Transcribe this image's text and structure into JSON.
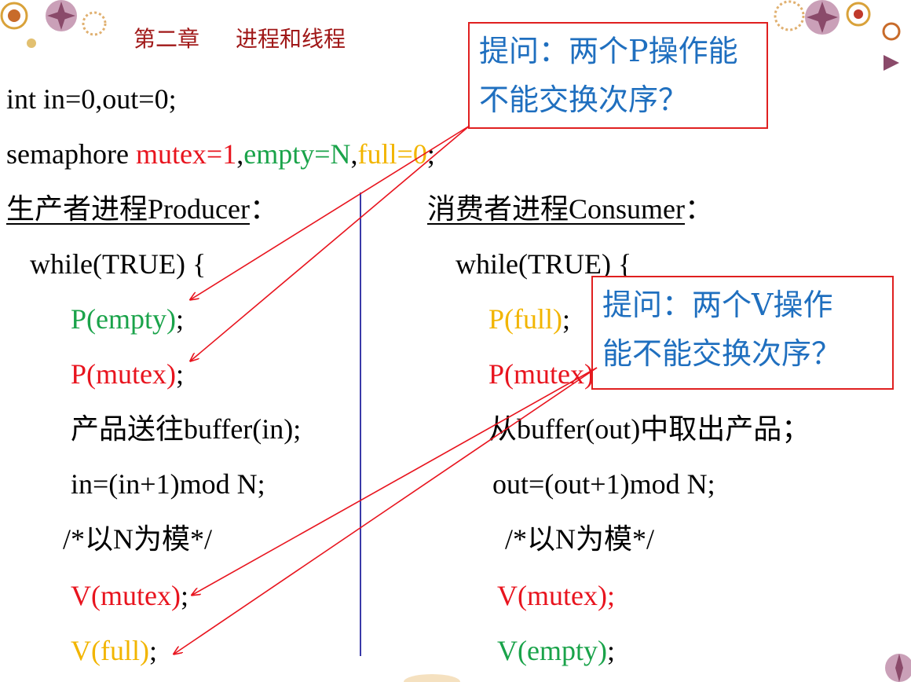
{
  "header": {
    "chapter": "第二章",
    "title": "进程和线程"
  },
  "decl": {
    "line1": "int in=0,out=0;",
    "semaphore_kw": "semaphore ",
    "mutex_init": "mutex=1",
    "comma1": ",",
    "empty_init": "empty=N",
    "comma2": ",",
    "full_init": "full=0",
    "semicolon": ";"
  },
  "producer": {
    "heading": "生产者进程Producer",
    "heading_colon": "：",
    "while": "while(TRUE) {",
    "p_empty": "P(empty)",
    "p_mutex": "P(mutex)",
    "put": "产品送往buffer(in);",
    "advance": "in=(in+1)mod N;",
    "comment": "/*以N为模*/",
    "v_mutex": "V(mutex)",
    "v_full": "V(full)",
    "semi": ";"
  },
  "consumer": {
    "heading": "消费者进程Consumer",
    "heading_colon": "：",
    "while": "while(TRUE) {",
    "p_full": "P(full)",
    "p_mutex": "P(mutex)",
    "take": "从buffer(out)中取出产品；",
    "advance": "out=(out+1)mod N;",
    "comment": "/*以N为模*/",
    "v_mutex": "V(mutex);",
    "v_empty": "V(empty)",
    "semi": ";"
  },
  "callouts": {
    "p_question_line1": "提问：两个P操作能",
    "p_question_line2": "不能交换次序？",
    "v_question_line1": "提问：两个V操作",
    "v_question_line2": "能不能交换次序？"
  },
  "colors": {
    "red": "#e8141e",
    "green": "#1aa34a",
    "orange": "#f2b500",
    "header": "#a01818",
    "callout_text": "#1f6fbf",
    "callout_border": "#e02020",
    "divider": "#3a3aa8"
  }
}
